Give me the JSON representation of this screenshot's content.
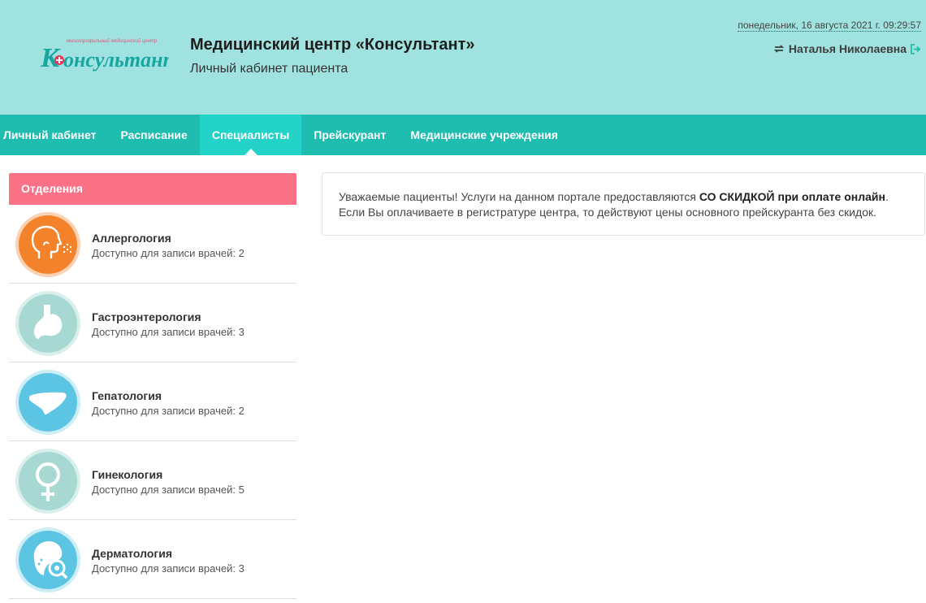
{
  "header": {
    "logo": {
      "small_text": "многопрофильный медицинский центр",
      "brand": "Консультант"
    },
    "title": "Медицинский центр «Консультант»",
    "subtitle": "Личный кабинет пациента",
    "datetime": "понедельник, 16 августа 2021 г. 09:29:57",
    "user_name": "Наталья Николаевна",
    "switch_icon": "switch-user-icon",
    "logout_icon": "logout-icon"
  },
  "nav": {
    "items": [
      {
        "label": "Личный кабинет"
      },
      {
        "label": "Расписание"
      },
      {
        "label": "Специалисты",
        "active": true
      },
      {
        "label": "Прейскурант"
      },
      {
        "label": "Медицинские учреждения"
      }
    ]
  },
  "sidebar": {
    "title": "Отделения",
    "departments": [
      {
        "name": "Аллергология",
        "count": "Доступно для записи врачей: 2",
        "icon": "allergy-icon",
        "color": "#f4822a"
      },
      {
        "name": "Гастроэнтерология",
        "count": "Доступно для записи врачей: 3",
        "icon": "stomach-icon",
        "color": "#a8d8d2"
      },
      {
        "name": "Гепатология",
        "count": "Доступно для записи врачей: 2",
        "icon": "liver-icon",
        "color": "#5bc5e3"
      },
      {
        "name": "Гинекология",
        "count": "Доступно для записи врачей: 5",
        "icon": "female-symbol-icon",
        "color": "#a8d8d2"
      },
      {
        "name": "Дерматология",
        "count": "Доступно для записи врачей: 3",
        "icon": "dermatology-icon",
        "color": "#5bc5e3"
      }
    ]
  },
  "notice": {
    "line1_start": "Уважаемые пациенты! Услуги на данном портале предоставляются ",
    "line1_bold": "СО СКИДКОЙ при оплате онлайн",
    "line1_end": ".",
    "line2": "Если Вы оплачиваете в регистратуре центра, то действуют цены основного прейскуранта без скидок."
  },
  "colors": {
    "header_bg": "#a0e2df",
    "nav_bg": "#1fbcb0",
    "nav_active": "#23d3c8",
    "dept_header": "#fb7185"
  }
}
